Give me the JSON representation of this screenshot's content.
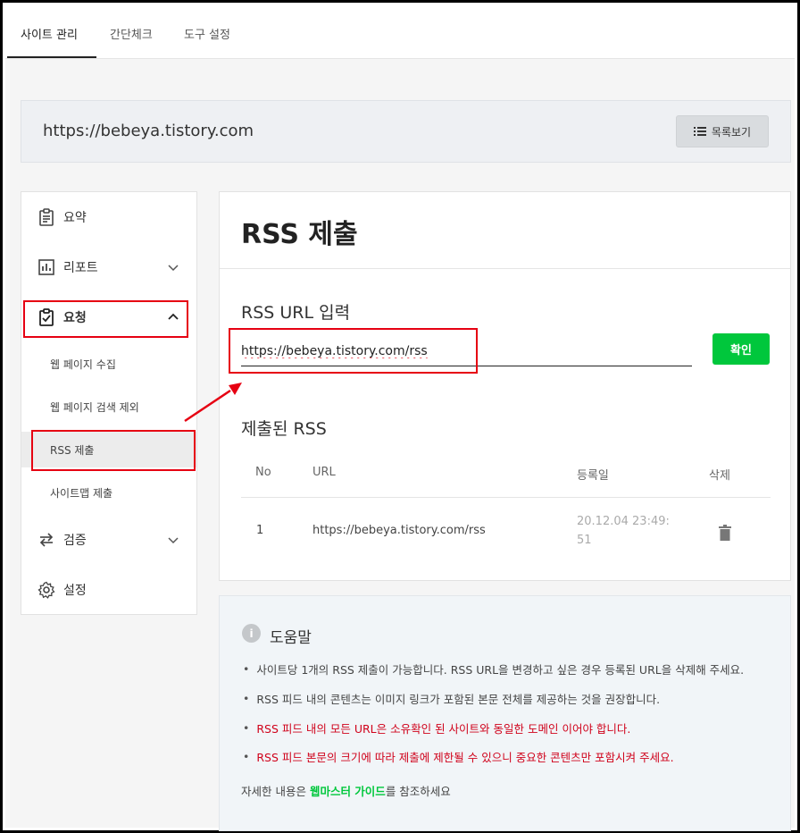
{
  "tabs": [
    "사이트 관리",
    "간단체크",
    "도구 설정"
  ],
  "site": {
    "url": "https://bebeya.tistory.com",
    "list_button": "목록보기"
  },
  "sidebar": {
    "items": [
      {
        "label": "요약",
        "icon": "clipboard-icon"
      },
      {
        "label": "리포트",
        "icon": "bar-chart-icon"
      },
      {
        "label": "요청",
        "icon": "clipboard-check-icon"
      },
      {
        "label": "검증",
        "icon": "sync-arrows-icon"
      },
      {
        "label": "설정",
        "icon": "gear-icon"
      }
    ],
    "sub_items": [
      "웹 페이지 수집",
      "웹 페이지 검색 제외",
      "RSS 제출",
      "사이트맵 제출"
    ]
  },
  "main": {
    "title": "RSS 제출",
    "rss_url_label": "RSS URL 입력",
    "rss_url_value": "https://bebeya.tistory.com/rss",
    "confirm_button": "확인",
    "submitted_label": "제출된 RSS",
    "table": {
      "headers": [
        "No",
        "URL",
        "등록일",
        "삭제"
      ],
      "rows": [
        {
          "no": "1",
          "url": "https://bebeya.tistory.com/rss",
          "date_line1": "20.12.04 23:49:",
          "date_line2": "51"
        }
      ]
    }
  },
  "help": {
    "title": "도움말",
    "bullets": [
      {
        "text": "사이트당 1개의 RSS 제출이 가능합니다. RSS URL을 변경하고 싶은 경우 등록된 URL을 삭제해 주세요.",
        "red": false
      },
      {
        "text": "RSS 피드 내의 콘텐츠는 이미지 링크가 포함된 본문 전체를 제공하는 것을 권장합니다.",
        "red": false
      },
      {
        "text": "RSS 피드 내의 모든 URL은 소유확인 된 사이트와 동일한 도메인 이어야 합니다.",
        "red": true
      },
      {
        "text": "RSS 피드 본문의 크기에 따라 제출에 제한될 수 있으니 중요한 콘텐츠만 포함시켜 주세요.",
        "red": true
      }
    ],
    "footer_prefix": "자세한 내용은 ",
    "footer_link": "웹마스터 가이드",
    "footer_suffix": "를 참조하세요"
  },
  "colors": {
    "accent_green": "#00c73c",
    "annotation_red": "#e60012",
    "warning_red": "#d0021b"
  }
}
